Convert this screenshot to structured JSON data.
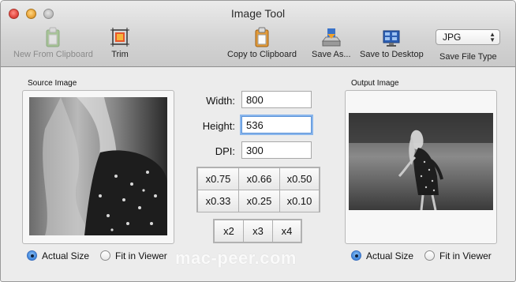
{
  "window": {
    "title": "Image Tool"
  },
  "toolbar": {
    "new_from_clipboard": {
      "label": "New From Clipboard",
      "icon": "clipboard-icon",
      "enabled": false
    },
    "trim": {
      "label": "Trim",
      "icon": "trim-icon"
    },
    "copy_to_clipboard": {
      "label": "Copy to Clipboard",
      "icon": "clipboard-icon"
    },
    "save_as": {
      "label": "Save As...",
      "icon": "save-drive-icon"
    },
    "save_to_desktop": {
      "label": "Save to Desktop",
      "icon": "desktop-icon"
    },
    "file_type": {
      "label": "Save File Type",
      "selected": "JPG"
    }
  },
  "source": {
    "title": "Source Image",
    "radio_actual": "Actual Size",
    "radio_fit": "Fit in Viewer",
    "selected": "actual"
  },
  "output": {
    "title": "Output Image",
    "radio_actual": "Actual Size",
    "radio_fit": "Fit in Viewer",
    "selected": "actual"
  },
  "fields": {
    "width_label": "Width:",
    "width_value": "800",
    "height_label": "Height:",
    "height_value": "536",
    "dpi_label": "DPI:",
    "dpi_value": "300"
  },
  "scale_buttons": [
    "x0.75",
    "x0.66",
    "x0.50",
    "x0.33",
    "x0.25",
    "x0.10"
  ],
  "multiply_buttons": [
    "x2",
    "x3",
    "x4"
  ],
  "watermark": "mac-peer.com",
  "colors": {
    "focus_ring": "#8ab6ec",
    "radio_selected": "#3f86dc"
  }
}
